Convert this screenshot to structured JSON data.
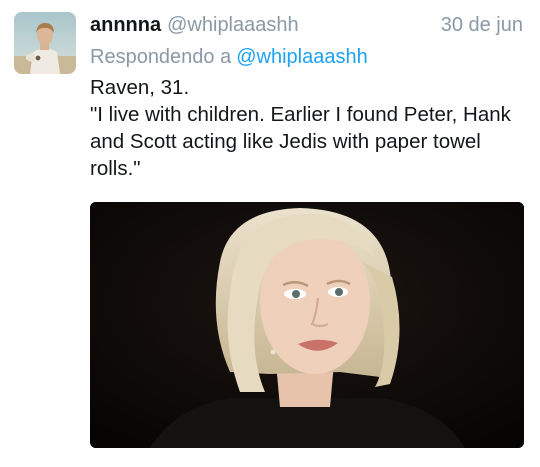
{
  "tweet": {
    "display_name": "annnna",
    "handle": "@whiplaaashh",
    "timestamp": "30 de jun",
    "reply_prefix": "Respondendo a",
    "reply_to": "@whiplaaashh",
    "text_line1": "Raven, 31.",
    "text_line2": "\"I live with children. Earlier I found Peter, Hank and Scott acting like Jedis with paper towel rolls.\""
  },
  "avatar": {
    "icon": "profile-photo"
  },
  "media": {
    "icon": "media-image",
    "description_color_bg": "#0f0b09"
  }
}
